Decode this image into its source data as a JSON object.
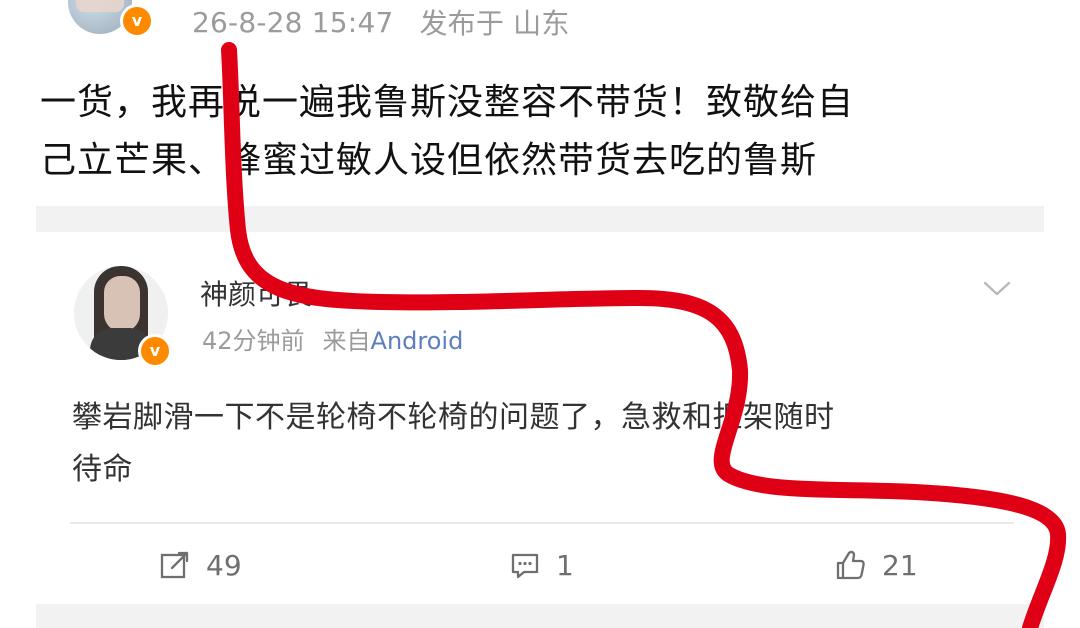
{
  "post": {
    "date_time": "26-8-28 15:47",
    "location": "发布于 山东",
    "quoted_text_lines": [
      "一货，我再说一遍我鲁斯没整容不带货！致敬给自",
      "己立芒果、蜂蜜过敏人设但依然带货去吃的鲁斯"
    ]
  },
  "comment": {
    "author": "神颜可畏",
    "time": "42分钟前",
    "from_prefix": "来自",
    "source": "Android",
    "text_lines": [
      "攀岩脚滑一下不是轮椅不轮椅的问题了，急救和担架随时",
      "待命"
    ]
  },
  "actions": {
    "forward_count": "49",
    "comment_count": "1",
    "like_count": "21"
  },
  "colors": {
    "vbadge": "#ff8a00",
    "annotation": "#e00016",
    "source_link": "#5d7fbf"
  },
  "icons": {
    "vbadge": "v",
    "forward": "share-icon",
    "comment": "comment-icon",
    "like": "thumbs-up-icon",
    "menu": "chevron-down-icon"
  }
}
